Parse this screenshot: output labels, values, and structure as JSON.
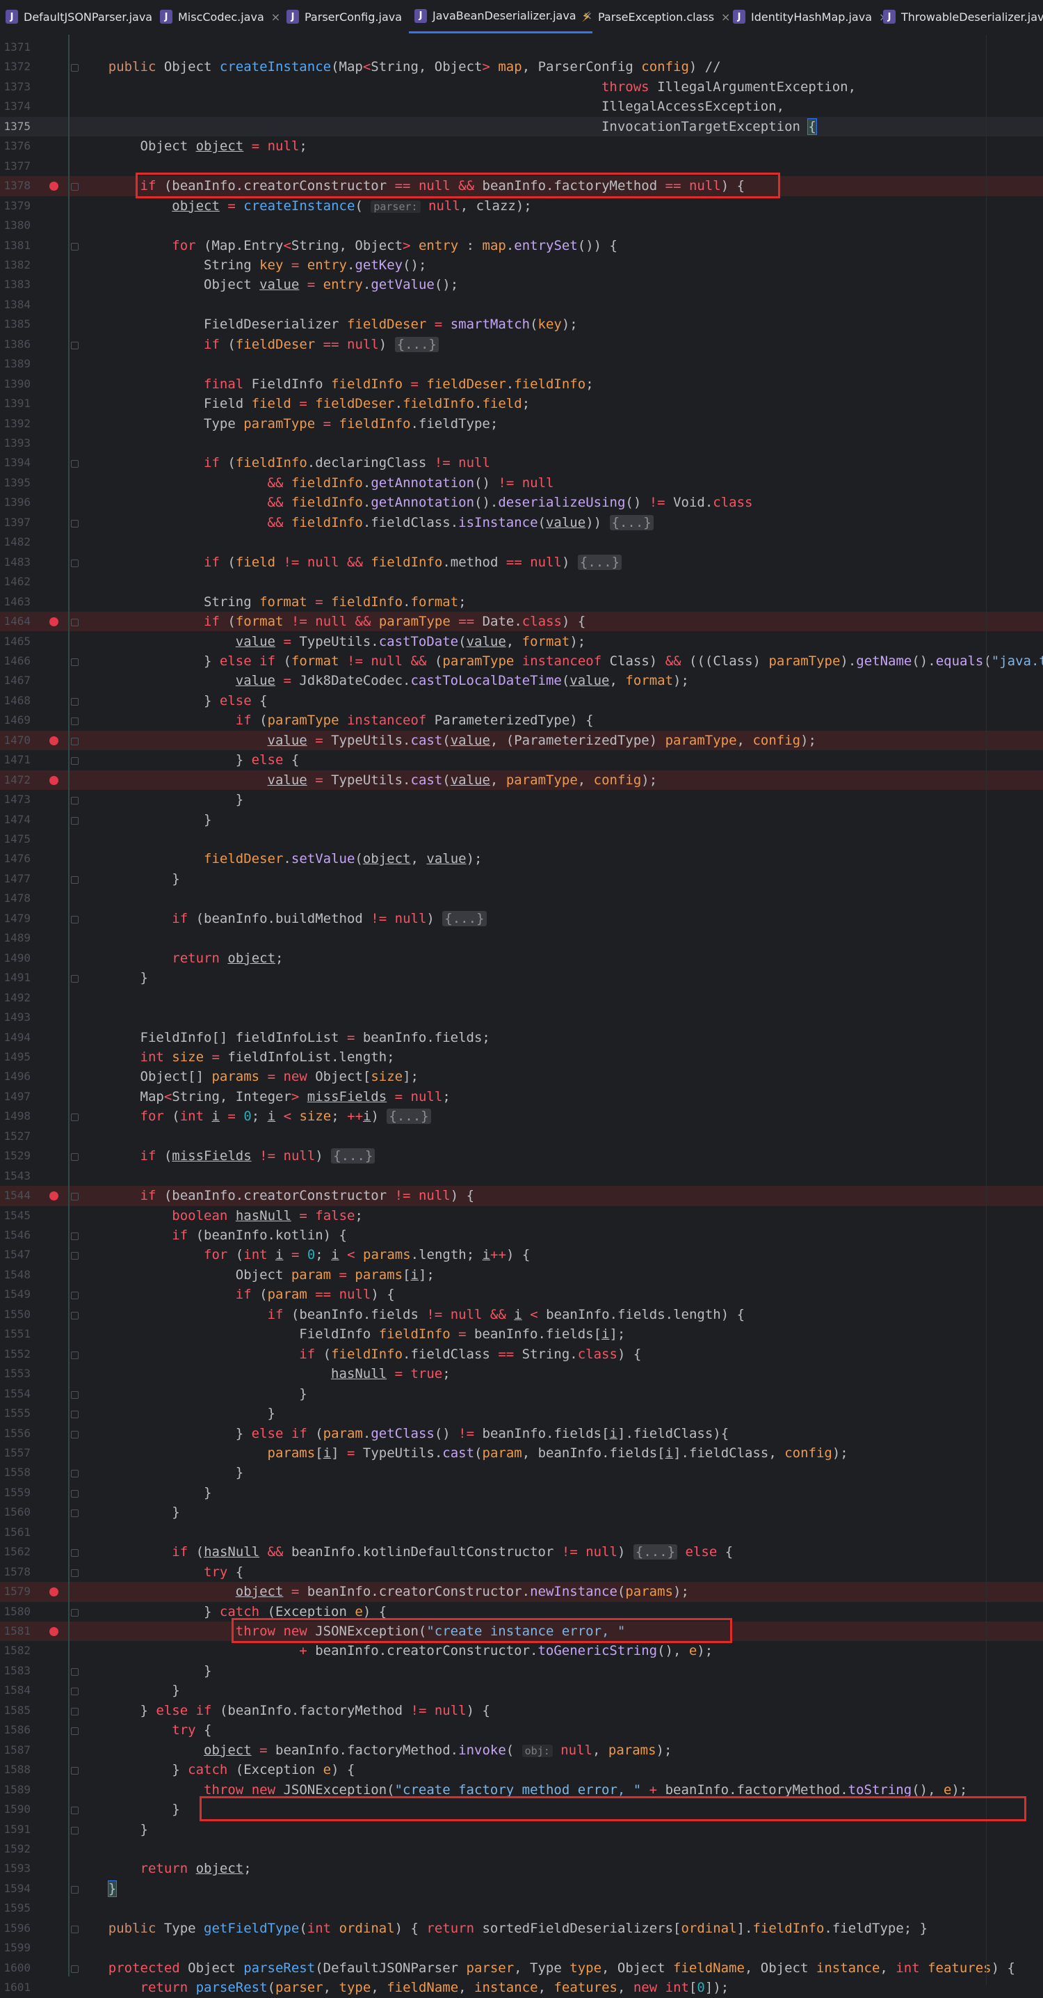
{
  "tabs": [
    {
      "label": "DefaultJSONParser.java",
      "type": "java"
    },
    {
      "label": "MiscCodec.java",
      "type": "java"
    },
    {
      "label": "ParserConfig.java",
      "type": "java"
    },
    {
      "label": "JavaBeanDeserializer.java",
      "type": "java",
      "active": true
    },
    {
      "label": "ParseException.class",
      "type": "class"
    },
    {
      "label": "IdentityHashMap.java",
      "type": "java"
    },
    {
      "label": "ThrowableDeserializer.java",
      "type": "java"
    }
  ],
  "icons": {
    "java_file": "java-file-icon",
    "class_file": "class-file-icon",
    "close": "close-icon",
    "breakpoint": "breakpoint-icon",
    "fold": "fold-marker-icon"
  },
  "colors": {
    "breakpoint": "#e3384a",
    "highlight_box": "#e02b2b",
    "active_tab": "#3574f0"
  },
  "code_lines": [
    {
      "n": "1371",
      "t": ""
    },
    {
      "n": "1372",
      "t": "    public Object createInstance(Map<String, Object> map, ParserConfig config) //"
    },
    {
      "n": "1373",
      "t": "                                                                  throws IllegalArgumentException,"
    },
    {
      "n": "1374",
      "t": "                                                                  IllegalAccessException,"
    },
    {
      "n": "1375",
      "t": "                                                                  InvocationTargetException {",
      "current": true
    },
    {
      "n": "1376",
      "t": "        Object object = null;"
    },
    {
      "n": "1377",
      "t": ""
    },
    {
      "n": "1378",
      "t": "        if (beanInfo.creatorConstructor == null && beanInfo.factoryMethod == null) {",
      "bp": true
    },
    {
      "n": "1379",
      "t": "            object = createInstance( parser: null, clazz);"
    },
    {
      "n": "1380",
      "t": ""
    },
    {
      "n": "1381",
      "t": "            for (Map.Entry<String, Object> entry : map.entrySet()) {"
    },
    {
      "n": "1382",
      "t": "                String key = entry.getKey();"
    },
    {
      "n": "1383",
      "t": "                Object value = entry.getValue();"
    },
    {
      "n": "1384",
      "t": ""
    },
    {
      "n": "1385",
      "t": "                FieldDeserializer fieldDeser = smartMatch(key);"
    },
    {
      "n": "1386",
      "t": "                if (fieldDeser == null) {...}"
    },
    {
      "n": "1389",
      "t": ""
    },
    {
      "n": "1390",
      "t": "                final FieldInfo fieldInfo = fieldDeser.fieldInfo;"
    },
    {
      "n": "1391",
      "t": "                Field field = fieldDeser.fieldInfo.field;"
    },
    {
      "n": "1392",
      "t": "                Type paramType = fieldInfo.fieldType;"
    },
    {
      "n": "1393",
      "t": ""
    },
    {
      "n": "1394",
      "t": "                if (fieldInfo.declaringClass != null"
    },
    {
      "n": "1395",
      "t": "                        && fieldInfo.getAnnotation() != null"
    },
    {
      "n": "1396",
      "t": "                        && fieldInfo.getAnnotation().deserializeUsing() != Void.class"
    },
    {
      "n": "1397",
      "t": "                        && fieldInfo.fieldClass.isInstance(value)) {...}"
    },
    {
      "n": "1482",
      "t": ""
    },
    {
      "n": "1483",
      "t": "                if (field != null && fieldInfo.method == null) {...}"
    },
    {
      "n": "1462",
      "t": ""
    },
    {
      "n": "1463",
      "t": "                String format = fieldInfo.format;"
    },
    {
      "n": "1464",
      "t": "                if (format != null && paramType == Date.class) {",
      "bp": true
    },
    {
      "n": "1465",
      "t": "                    value = TypeUtils.castToDate(value, format);"
    },
    {
      "n": "1466",
      "t": "                } else if (format != null && (paramType instanceof Class) && (((Class) paramType).getName().equals(\"java.time.Lo"
    },
    {
      "n": "1467",
      "t": "                    value = Jdk8DateCodec.castToLocalDateTime(value, format);"
    },
    {
      "n": "1468",
      "t": "                } else {"
    },
    {
      "n": "1469",
      "t": "                    if (paramType instanceof ParameterizedType) {"
    },
    {
      "n": "1470",
      "t": "                        value = TypeUtils.cast(value, (ParameterizedType) paramType, config);",
      "bp": true
    },
    {
      "n": "1471",
      "t": "                    } else {"
    },
    {
      "n": "1472",
      "t": "                        value = TypeUtils.cast(value, paramType, config);",
      "bp": true
    },
    {
      "n": "1473",
      "t": "                    }"
    },
    {
      "n": "1474",
      "t": "                }"
    },
    {
      "n": "1475",
      "t": ""
    },
    {
      "n": "1476",
      "t": "                fieldDeser.setValue(object, value);"
    },
    {
      "n": "1477",
      "t": "            }"
    },
    {
      "n": "1478",
      "t": ""
    },
    {
      "n": "1479",
      "t": "            if (beanInfo.buildMethod != null) {...}"
    },
    {
      "n": "1489",
      "t": ""
    },
    {
      "n": "1490",
      "t": "            return object;"
    },
    {
      "n": "1491",
      "t": "        }"
    },
    {
      "n": "1492",
      "t": ""
    },
    {
      "n": "1493",
      "t": ""
    },
    {
      "n": "1494",
      "t": "        FieldInfo[] fieldInfoList = beanInfo.fields;"
    },
    {
      "n": "1495",
      "t": "        int size = fieldInfoList.length;"
    },
    {
      "n": "1496",
      "t": "        Object[] params = new Object[size];"
    },
    {
      "n": "1497",
      "t": "        Map<String, Integer> missFields = null;"
    },
    {
      "n": "1498",
      "t": "        for (int i = 0; i < size; ++i) {...}"
    },
    {
      "n": "1527",
      "t": ""
    },
    {
      "n": "1529",
      "t": "        if (missFields != null) {...}"
    },
    {
      "n": "1543",
      "t": ""
    },
    {
      "n": "1544",
      "t": "        if (beanInfo.creatorConstructor != null) {",
      "bp": true
    },
    {
      "n": "1545",
      "t": "            boolean hasNull = false;"
    },
    {
      "n": "1546",
      "t": "            if (beanInfo.kotlin) {"
    },
    {
      "n": "1547",
      "t": "                for (int i = 0; i < params.length; i++) {"
    },
    {
      "n": "1548",
      "t": "                    Object param = params[i];"
    },
    {
      "n": "1549",
      "t": "                    if (param == null) {"
    },
    {
      "n": "1550",
      "t": "                        if (beanInfo.fields != null && i < beanInfo.fields.length) {"
    },
    {
      "n": "1551",
      "t": "                            FieldInfo fieldInfo = beanInfo.fields[i];"
    },
    {
      "n": "1552",
      "t": "                            if (fieldInfo.fieldClass == String.class) {"
    },
    {
      "n": "1553",
      "t": "                                hasNull = true;"
    },
    {
      "n": "1554",
      "t": "                            }"
    },
    {
      "n": "1555",
      "t": "                        }"
    },
    {
      "n": "1556",
      "t": "                    } else if (param.getClass() != beanInfo.fields[i].fieldClass){"
    },
    {
      "n": "1557",
      "t": "                        params[i] = TypeUtils.cast(param, beanInfo.fields[i].fieldClass, config);"
    },
    {
      "n": "1558",
      "t": "                    }"
    },
    {
      "n": "1559",
      "t": "                }"
    },
    {
      "n": "1560",
      "t": "            }"
    },
    {
      "n": "1561",
      "t": ""
    },
    {
      "n": "1562",
      "t": "            if (hasNull && beanInfo.kotlinDefaultConstructor != null) {...} else {"
    },
    {
      "n": "1578",
      "t": "                try {"
    },
    {
      "n": "1579",
      "t": "                    object = beanInfo.creatorConstructor.newInstance(params);",
      "bp": true
    },
    {
      "n": "1580",
      "t": "                } catch (Exception e) {"
    },
    {
      "n": "1581",
      "t": "                    throw new JSONException(\"create instance error, \"",
      "bp": true
    },
    {
      "n": "1582",
      "t": "                            + beanInfo.creatorConstructor.toGenericString(), e);"
    },
    {
      "n": "1583",
      "t": "                }"
    },
    {
      "n": "1584",
      "t": "            }"
    },
    {
      "n": "1585",
      "t": "        } else if (beanInfo.factoryMethod != null) {"
    },
    {
      "n": "1586",
      "t": "            try {"
    },
    {
      "n": "1587",
      "t": "                object = beanInfo.factoryMethod.invoke( obj: null, params);"
    },
    {
      "n": "1588",
      "t": "            } catch (Exception e) {"
    },
    {
      "n": "1589",
      "t": "                throw new JSONException(\"create factory method error, \" + beanInfo.factoryMethod.toString(), e);"
    },
    {
      "n": "1590",
      "t": "            }"
    },
    {
      "n": "1591",
      "t": "        }"
    },
    {
      "n": "1592",
      "t": ""
    },
    {
      "n": "1593",
      "t": "        return object;"
    },
    {
      "n": "1594",
      "t": "    }"
    },
    {
      "n": "1595",
      "t": ""
    },
    {
      "n": "1596",
      "t": "    public Type getFieldType(int ordinal) { return sortedFieldDeserializers[ordinal].fieldInfo.fieldType; }"
    },
    {
      "n": "1599",
      "t": ""
    },
    {
      "n": "1600",
      "t": "    protected Object parseRest(DefaultJSONParser parser, Type type, Object fieldName, Object instance, int features) {"
    },
    {
      "n": "1601",
      "t": "        return parseRest(parser, type, fieldName, instance, features, new int[0]);"
    }
  ]
}
